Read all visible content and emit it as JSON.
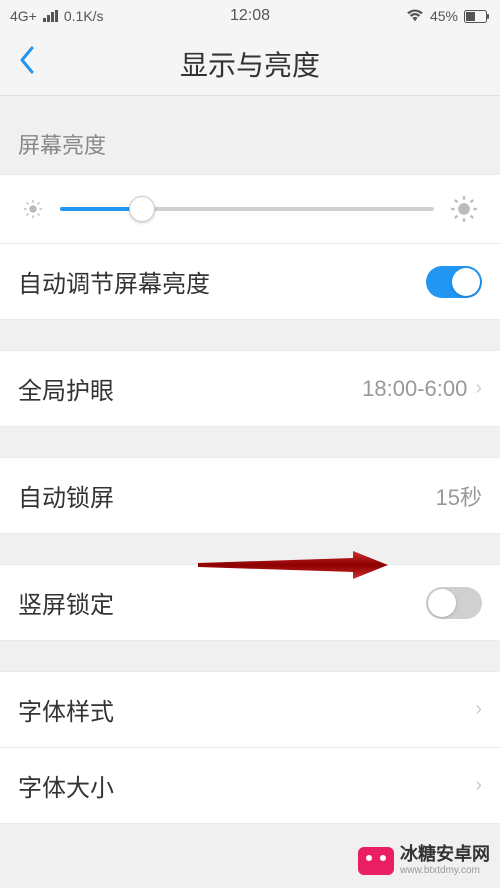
{
  "status_bar": {
    "network_type": "4G+",
    "data_rate": "0.1K/s",
    "time": "12:08",
    "battery_percent": "45%"
  },
  "header": {
    "title": "显示与亮度"
  },
  "brightness_section": {
    "title": "屏幕亮度"
  },
  "rows": {
    "auto_brightness": {
      "label": "自动调节屏幕亮度",
      "toggle_on": true
    },
    "eye_care": {
      "label": "全局护眼",
      "value": "18:00-6:00"
    },
    "auto_lock": {
      "label": "自动锁屏",
      "value": "15秒"
    },
    "portrait_lock": {
      "label": "竖屏锁定",
      "toggle_on": false
    },
    "font_style": {
      "label": "字体样式"
    },
    "font_size": {
      "label": "字体大小"
    }
  },
  "watermark": {
    "main": "冰糖安卓网",
    "sub": "www.btxtdmy.com"
  }
}
